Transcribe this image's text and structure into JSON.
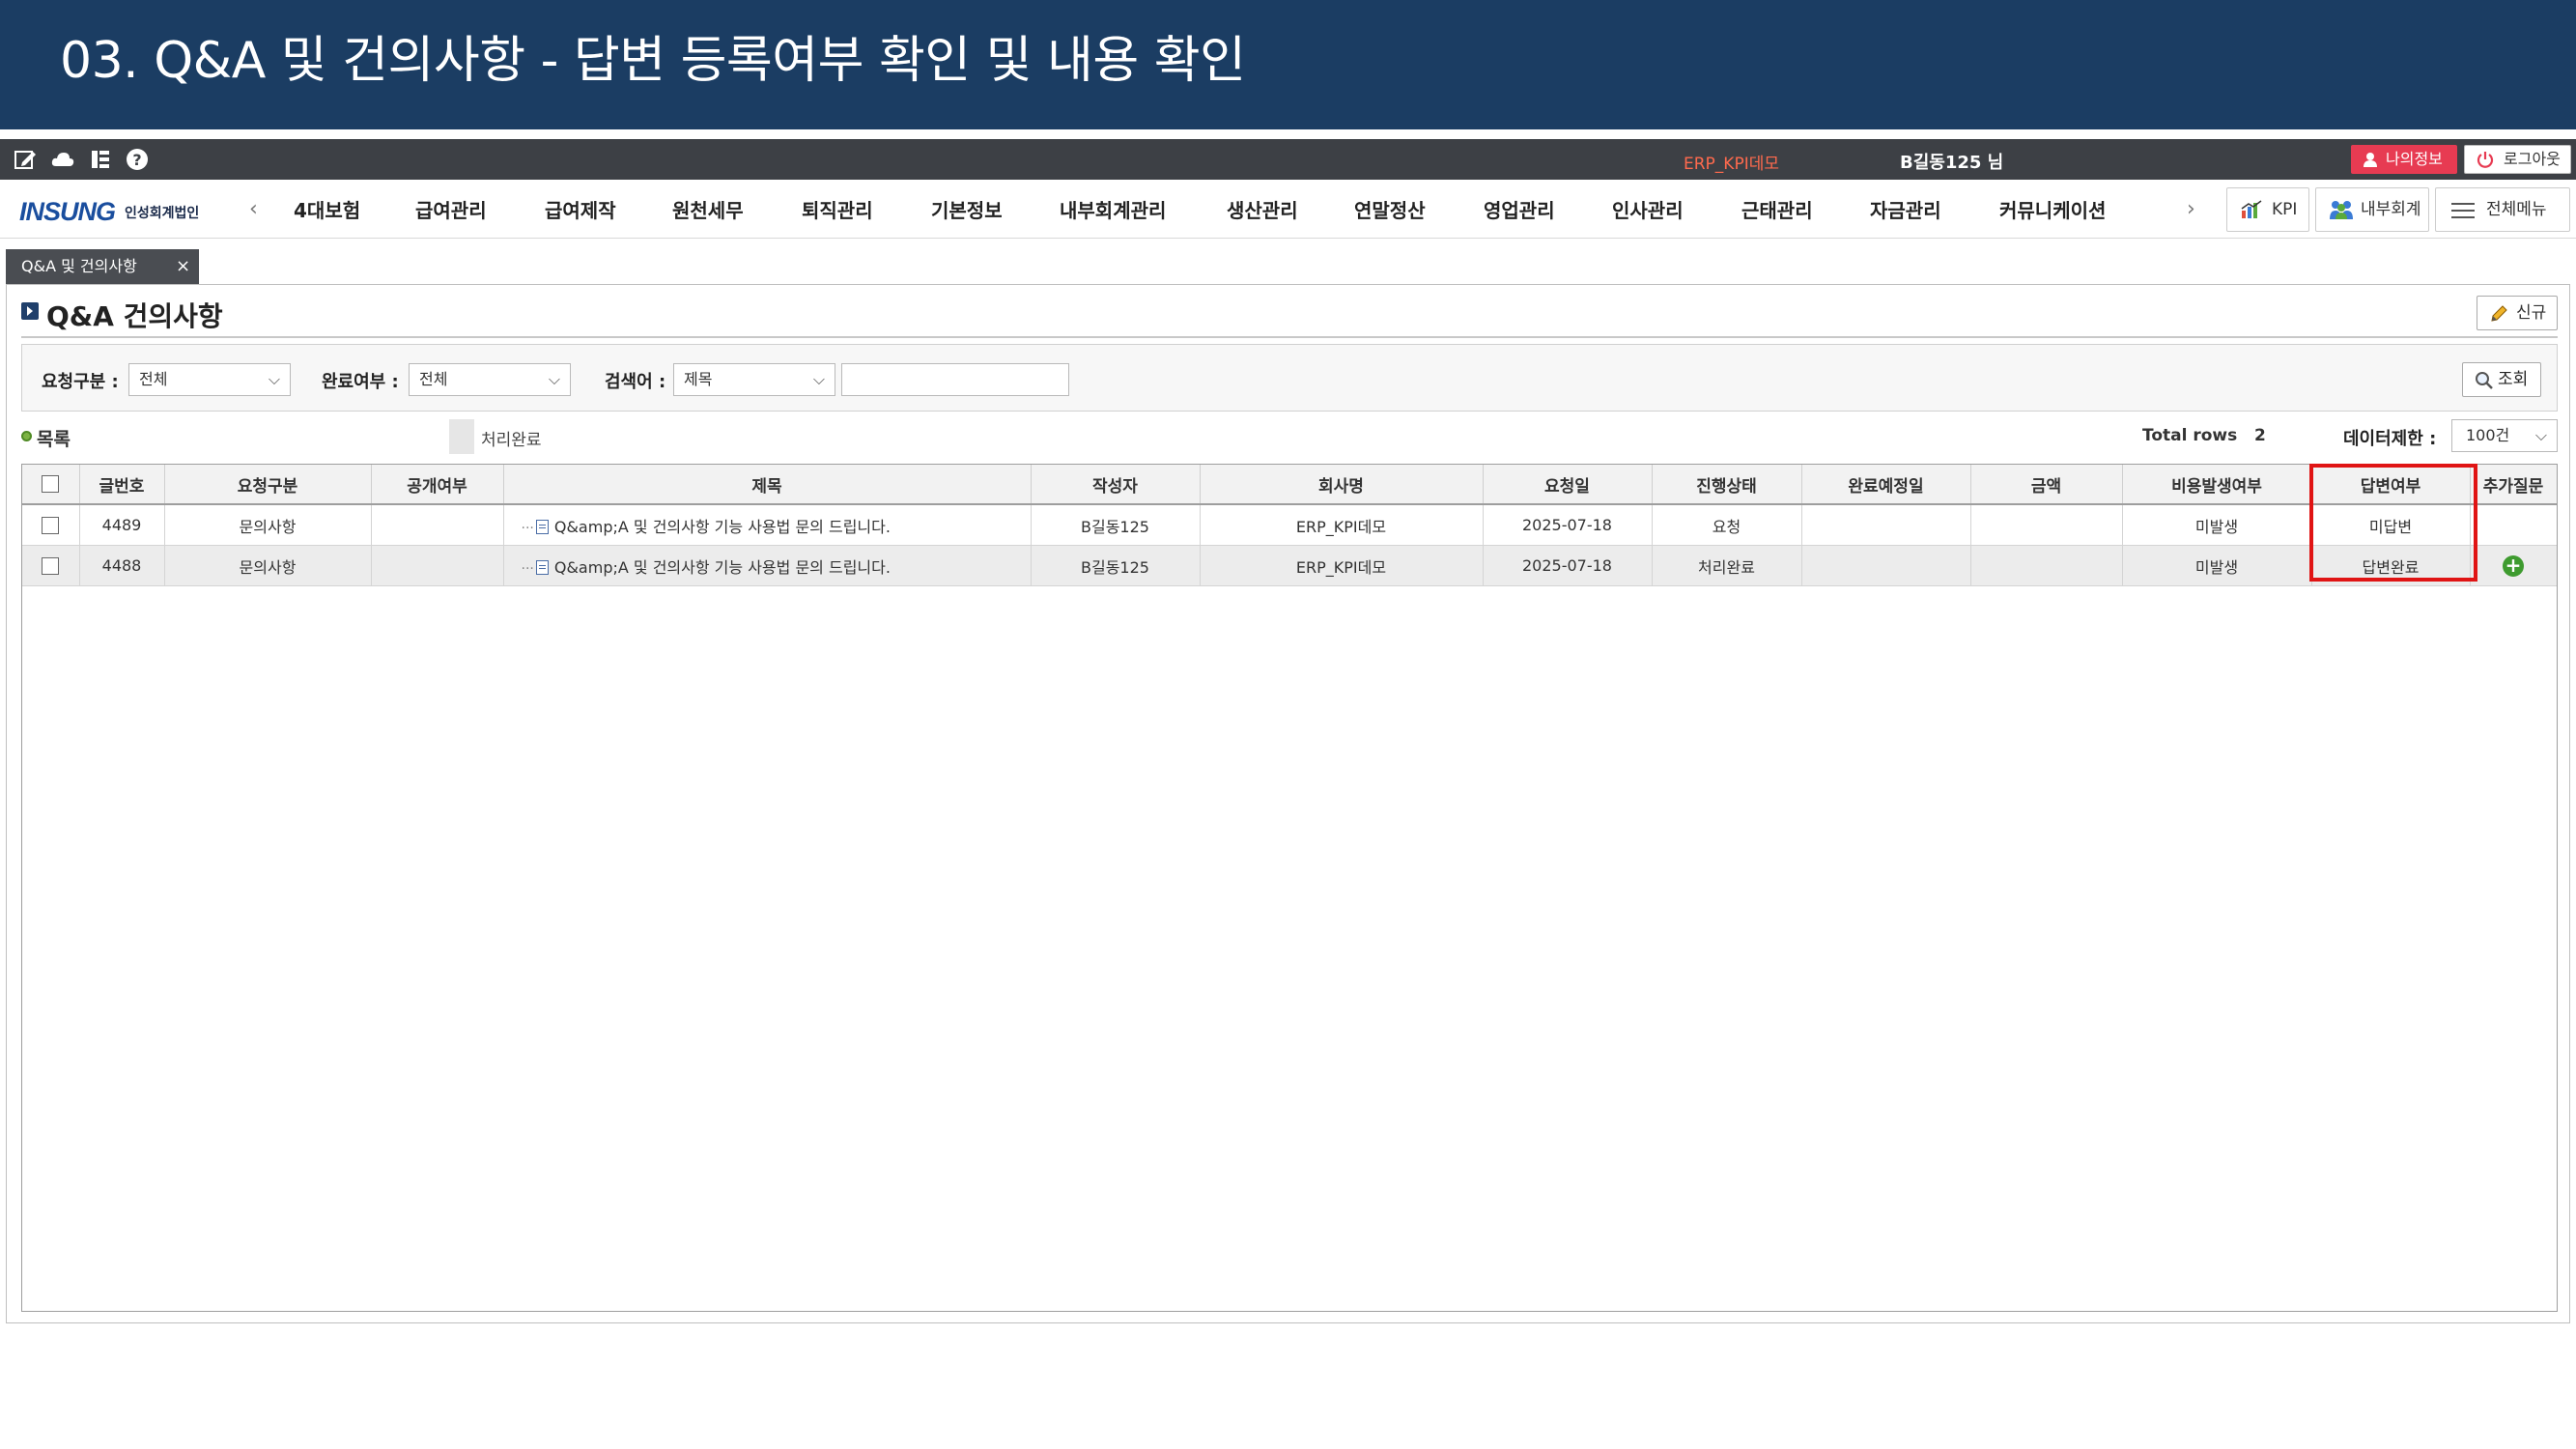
{
  "slide": {
    "title": "03. Q&A 및 건의사항 - 답변 등록여부 확인 및 내용 확인"
  },
  "topbar": {
    "company": "ERP_KPI데모",
    "user": "B길동125 님",
    "myinfo_label": "나의정보",
    "logout_label": "로그아웃"
  },
  "nav": {
    "logo_main": "INSUNG",
    "logo_sub": "인성회계법인",
    "prev_arrow": "‹",
    "next_arrow": "›",
    "items": [
      "4대보험",
      "급여관리",
      "급여제작",
      "원천세무",
      "퇴직관리",
      "기본정보",
      "내부회계관리",
      "생산관리",
      "연말정산",
      "영업관리",
      "인사관리",
      "근태관리",
      "자금관리",
      "커뮤니케이션"
    ],
    "kpi_label": "KPI",
    "internal_label": "내부회계",
    "allmenu_label": "전체메뉴"
  },
  "tab": {
    "label": "Q&A 및 건의사항",
    "close": "×"
  },
  "page": {
    "title": "Q&A 건의사항",
    "new_label": "신규"
  },
  "search": {
    "req_type_label": "요청구분 :",
    "req_type_value": "전체",
    "done_label": "완료여부 :",
    "done_value": "전체",
    "keyword_label": "검색어 :",
    "keyword_type_value": "제목",
    "keyword_value": "",
    "search_label": "조회"
  },
  "list": {
    "label": "목록",
    "legend_label": "처리완료",
    "total_label": "Total rows",
    "total_value": "2",
    "limit_label": "데이터제한 :",
    "limit_value": "100건"
  },
  "table": {
    "headers": [
      "",
      "글번호",
      "요청구분",
      "공개여부",
      "제목",
      "작성자",
      "회사명",
      "요청일",
      "진행상태",
      "완료예정일",
      "금액",
      "비용발생여부",
      "답변여부",
      "추가질문"
    ],
    "rows": [
      {
        "no": "4489",
        "req_type": "문의사항",
        "public": "",
        "title": "Q&amp;A 및 건의사항 기능 사용법 문의 드립니다.",
        "author": "B길동125",
        "company": "ERP_KPI데모",
        "date": "2025-07-18",
        "status": "요청",
        "due": "",
        "amount": "",
        "cost": "미발생",
        "answer": "미답변",
        "followup": ""
      },
      {
        "no": "4488",
        "req_type": "문의사항",
        "public": "",
        "title": "Q&amp;A 및 건의사항 기능 사용법 문의 드립니다.",
        "author": "B길동125",
        "company": "ERP_KPI데모",
        "date": "2025-07-18",
        "status": "처리완료",
        "due": "",
        "amount": "",
        "cost": "미발생",
        "answer": "답변완료",
        "followup": "+"
      }
    ]
  },
  "colors": {
    "header_bg": "#1b3d63",
    "topbar_bg": "#3d4045",
    "highlight": "#e01414",
    "myinfo_bg": "#e73b52",
    "plus": "#3e9b2f"
  }
}
